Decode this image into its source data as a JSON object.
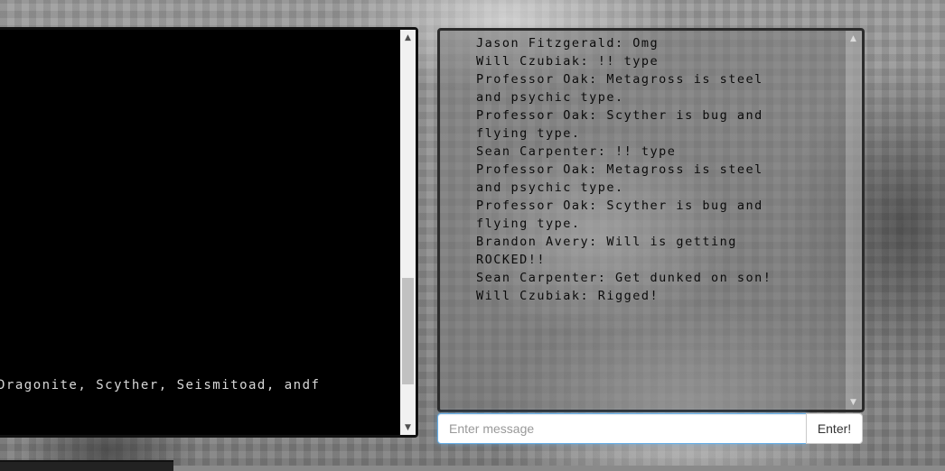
{
  "game": {
    "text": "Dragonite, Scyther, Seismitoad, and",
    "text_prefix": "f "
  },
  "chat": {
    "messages": [
      "Jason Fitzgerald: Omg",
      "Will Czubiak: !! type",
      "Professor Oak: Metagross is steel",
      "and psychic type.",
      "Professor Oak: Scyther is bug and",
      "flying type.",
      "Sean Carpenter: !! type",
      "Professor Oak: Metagross is steel",
      "and psychic type.",
      "Professor Oak: Scyther is bug and",
      "flying type.",
      "Brandon Avery: Will is getting",
      "ROCKED!!",
      "Sean Carpenter: Get dunked on son!",
      "Will Czubiak: Rigged!"
    ],
    "input": {
      "placeholder": "Enter message",
      "value": ""
    },
    "send_label": "Enter!"
  },
  "scroll": {
    "game_console_position": 0.87,
    "chat_log_position": 0.0
  },
  "icons": {
    "scroll_up": "chevron-up-icon",
    "scroll_down": "chevron-down-icon"
  },
  "colors": {
    "console_bg": "#000000",
    "console_text": "#d8d8d8",
    "input_focus": "#66afe9"
  }
}
